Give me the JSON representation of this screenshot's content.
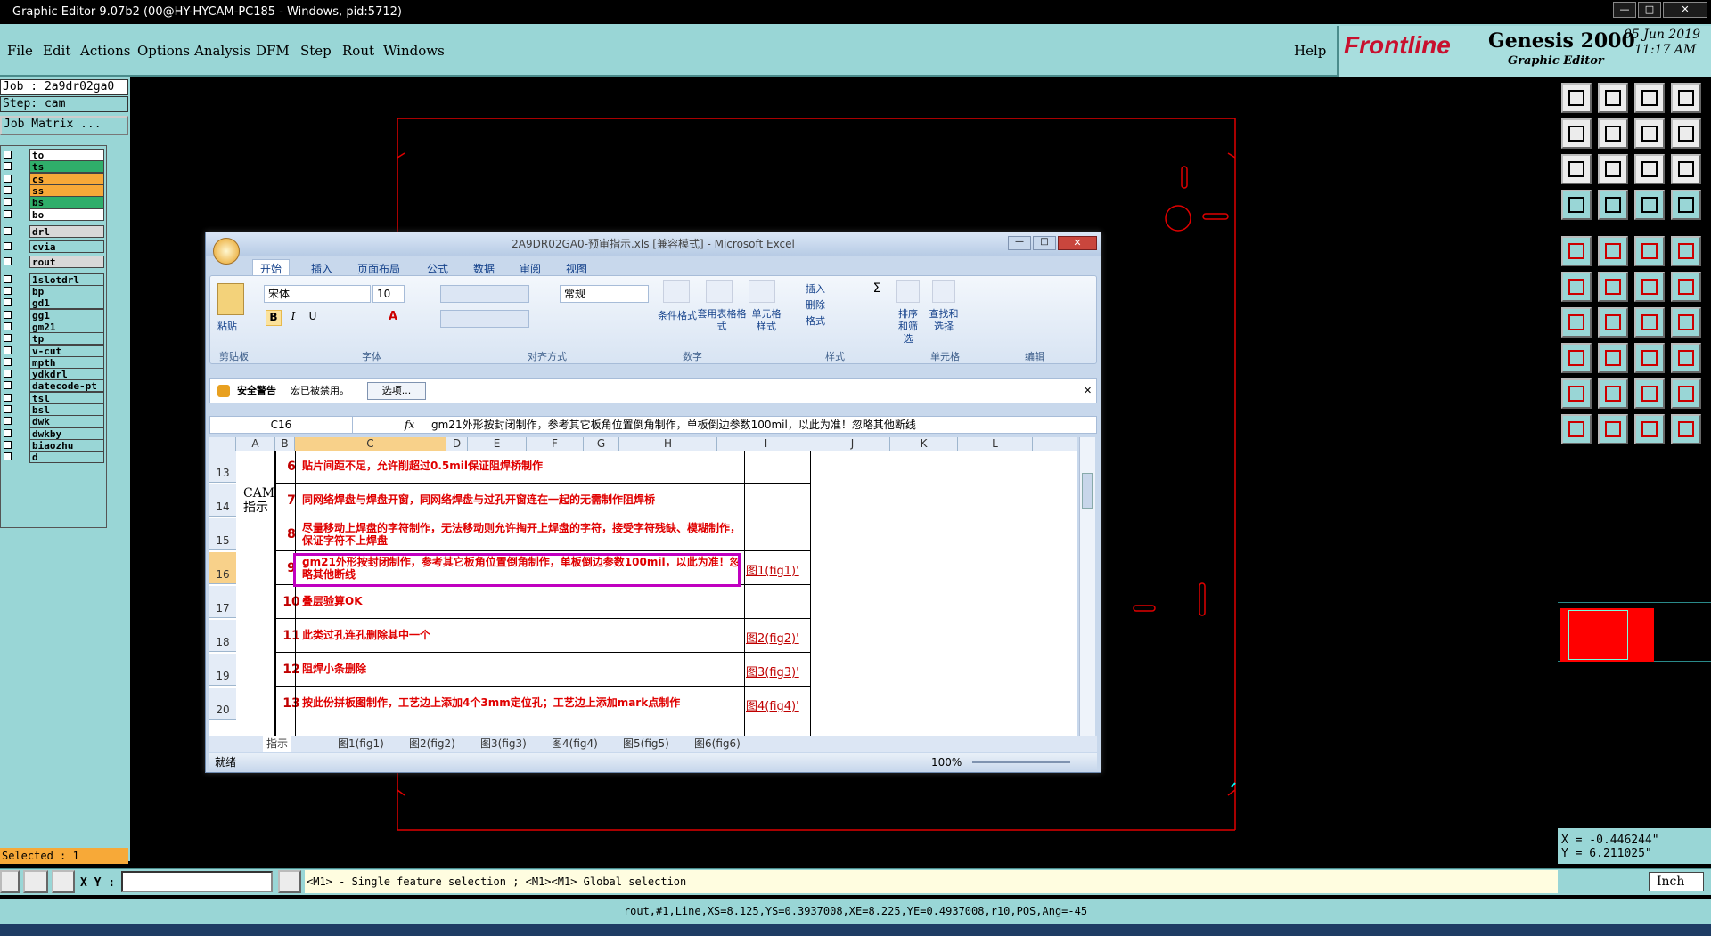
{
  "window": {
    "title": "Graphic Editor 9.07b2 (00@HY-HYCAM-PC185 - Windows, pid:5712)"
  },
  "menu": {
    "items": [
      "File",
      "Edit",
      "Actions",
      "Options",
      "Analysis",
      "DFM",
      "Step",
      "Rout",
      "Windows"
    ],
    "help": "Help"
  },
  "brand": {
    "logo": "Frontline",
    "product": "Genesis 2000",
    "subtitle": "Graphic Editor",
    "date": "05 Jun 2019",
    "time": "11:17 AM"
  },
  "job": {
    "job": "Job : 2a9dr02ga0",
    "step": "Step: cam",
    "matrix": "Job Matrix ..."
  },
  "layers": [
    {
      "name": "to",
      "color": "white"
    },
    {
      "name": "ts",
      "color": "green"
    },
    {
      "name": "cs",
      "color": "orange"
    },
    {
      "name": "ss",
      "color": "orange"
    },
    {
      "name": "bs",
      "color": "green"
    },
    {
      "name": "bo",
      "color": "white"
    },
    {
      "name": "drl",
      "color": "gray"
    },
    {
      "name": "cvia",
      "color": "cyan"
    },
    {
      "name": "rout",
      "color": "gray"
    },
    {
      "name": "1slotdrl",
      "color": "cyan"
    },
    {
      "name": "bp",
      "color": "cyan"
    },
    {
      "name": "gd1",
      "color": "cyan"
    },
    {
      "name": "gg1",
      "color": "cyan"
    },
    {
      "name": "gm21",
      "color": "cyan"
    },
    {
      "name": "tp",
      "color": "cyan"
    },
    {
      "name": "v-cut",
      "color": "cyan"
    },
    {
      "name": "mpth",
      "color": "cyan"
    },
    {
      "name": "ydkdrl",
      "color": "cyan"
    },
    {
      "name": "datecode-pt",
      "color": "cyan"
    },
    {
      "name": "tsl",
      "color": "cyan"
    },
    {
      "name": "bsl",
      "color": "cyan"
    },
    {
      "name": "dwk",
      "color": "cyan"
    },
    {
      "name": "dwkby",
      "color": "cyan"
    },
    {
      "name": "biaozhu",
      "color": "cyan"
    },
    {
      "name": "d",
      "color": "cyan"
    }
  ],
  "selected": "Selected : 1",
  "command": {
    "xy_label": "X Y :",
    "hint": "<M1> - Single feature selection ; <M1><M1> Global selection"
  },
  "status_line": "rout,#1,Line,XS=8.125,YS=0.3937008,XE=8.225,YE=0.4937008,r10,POS,Ang=-45",
  "coords": {
    "x": "X = -0.446244\"",
    "y": "Y = 6.211025\"",
    "unit": "Inch"
  },
  "excel": {
    "title": "2A9DR02GA0-预审指示.xls [兼容模式] - Microsoft Excel",
    "tabs": [
      "开始",
      "插入",
      "页面布局",
      "公式",
      "数据",
      "审阅",
      "视图"
    ],
    "groups": [
      "剪贴板",
      "字体",
      "对齐方式",
      "数字",
      "样式",
      "单元格",
      "编辑"
    ],
    "ribbon": {
      "paste": "粘贴",
      "font": "宋体",
      "size": "10",
      "number_format": "常规",
      "cond_format": "条件格式",
      "table_format": "套用表格格式",
      "cell_style": "单元格样式",
      "insert": "插入",
      "delete": "删除",
      "format": "格式",
      "sort": "排序和筛选",
      "find": "查找和选择"
    },
    "security": {
      "label": "安全警告",
      "msg": "宏已被禁用。",
      "button": "选项..."
    },
    "name_box": "C16",
    "fx": "fx",
    "formula": "gm21外形按封闭制作，参考其它板角位置倒角制作，单板倒边参数100mil，以此为准！忽略其他断线",
    "columns": [
      "A",
      "B",
      "C",
      "D",
      "E",
      "F",
      "G",
      "H",
      "I",
      "J",
      "K",
      "L"
    ],
    "cam_label": "CAM指示",
    "rows": [
      {
        "row": "13",
        "num": "6",
        "text": "贴片间距不足，允许削超过0.5mil保证阻焊桥制作",
        "ref": ""
      },
      {
        "row": "14",
        "num": "7",
        "text": "同网络焊盘与焊盘开窗，同网络焊盘与过孔开窗连在一起的无需制作阻焊桥",
        "ref": ""
      },
      {
        "row": "15",
        "num": "8",
        "text": "尽量移动上焊盘的字符制作，无法移动则允许掏开上焊盘的字符，接受字符残缺、模糊制作，保证字符不上焊盘",
        "ref": ""
      },
      {
        "row": "16",
        "num": "9",
        "text": "gm21外形按封闭制作，参考其它板角位置倒角制作，单板倒边参数100mil，以此为准！忽略其他断线",
        "ref": "图1(fig1)'"
      },
      {
        "row": "17",
        "num": "10",
        "text": "叠层验算OK",
        "ref": ""
      },
      {
        "row": "18",
        "num": "11",
        "text": "此类过孔连孔删除其中一个",
        "ref": "图2(fig2)'"
      },
      {
        "row": "19",
        "num": "12",
        "text": "阻焊小条删除",
        "ref": "图3(fig3)'"
      },
      {
        "row": "20",
        "num": "13",
        "text": "按此份拼板图制作，工艺边上添加4个3mm定位孔；工艺边上添加mark点制作",
        "ref": "图4(fig4)'"
      }
    ],
    "sheet_tabs": [
      "指示",
      "图1(fig1)",
      "图2(fig2)",
      "图3(fig3)",
      "图4(fig4)",
      "图5(fig5)",
      "图6(fig6)"
    ],
    "status": "就绪",
    "zoom": "100%"
  }
}
